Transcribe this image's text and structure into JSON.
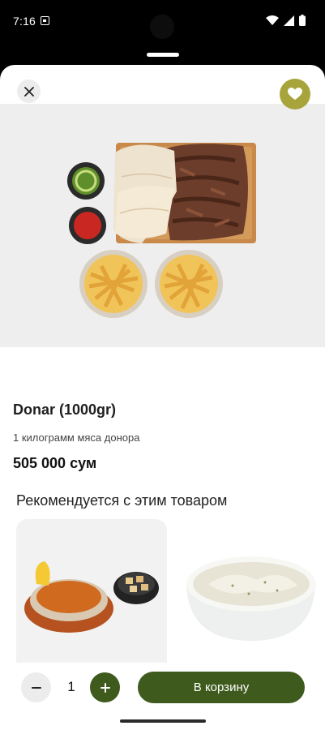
{
  "status": {
    "time": "7:16"
  },
  "header": {
    "close_icon": "close-icon",
    "favorite_icon": "heart-icon",
    "accent": "#a7a43c"
  },
  "product": {
    "title": "Donar (1000gr)",
    "description": "1 килограмм мяса донора",
    "price": "505 000 сум"
  },
  "recommendations": {
    "title": "Рекомендуется с этим товаром"
  },
  "footer": {
    "quantity": "1",
    "minus_symbol": "−",
    "plus_symbol": "+",
    "cart_label": "В корзину",
    "primary_color": "#3e5a1d"
  }
}
